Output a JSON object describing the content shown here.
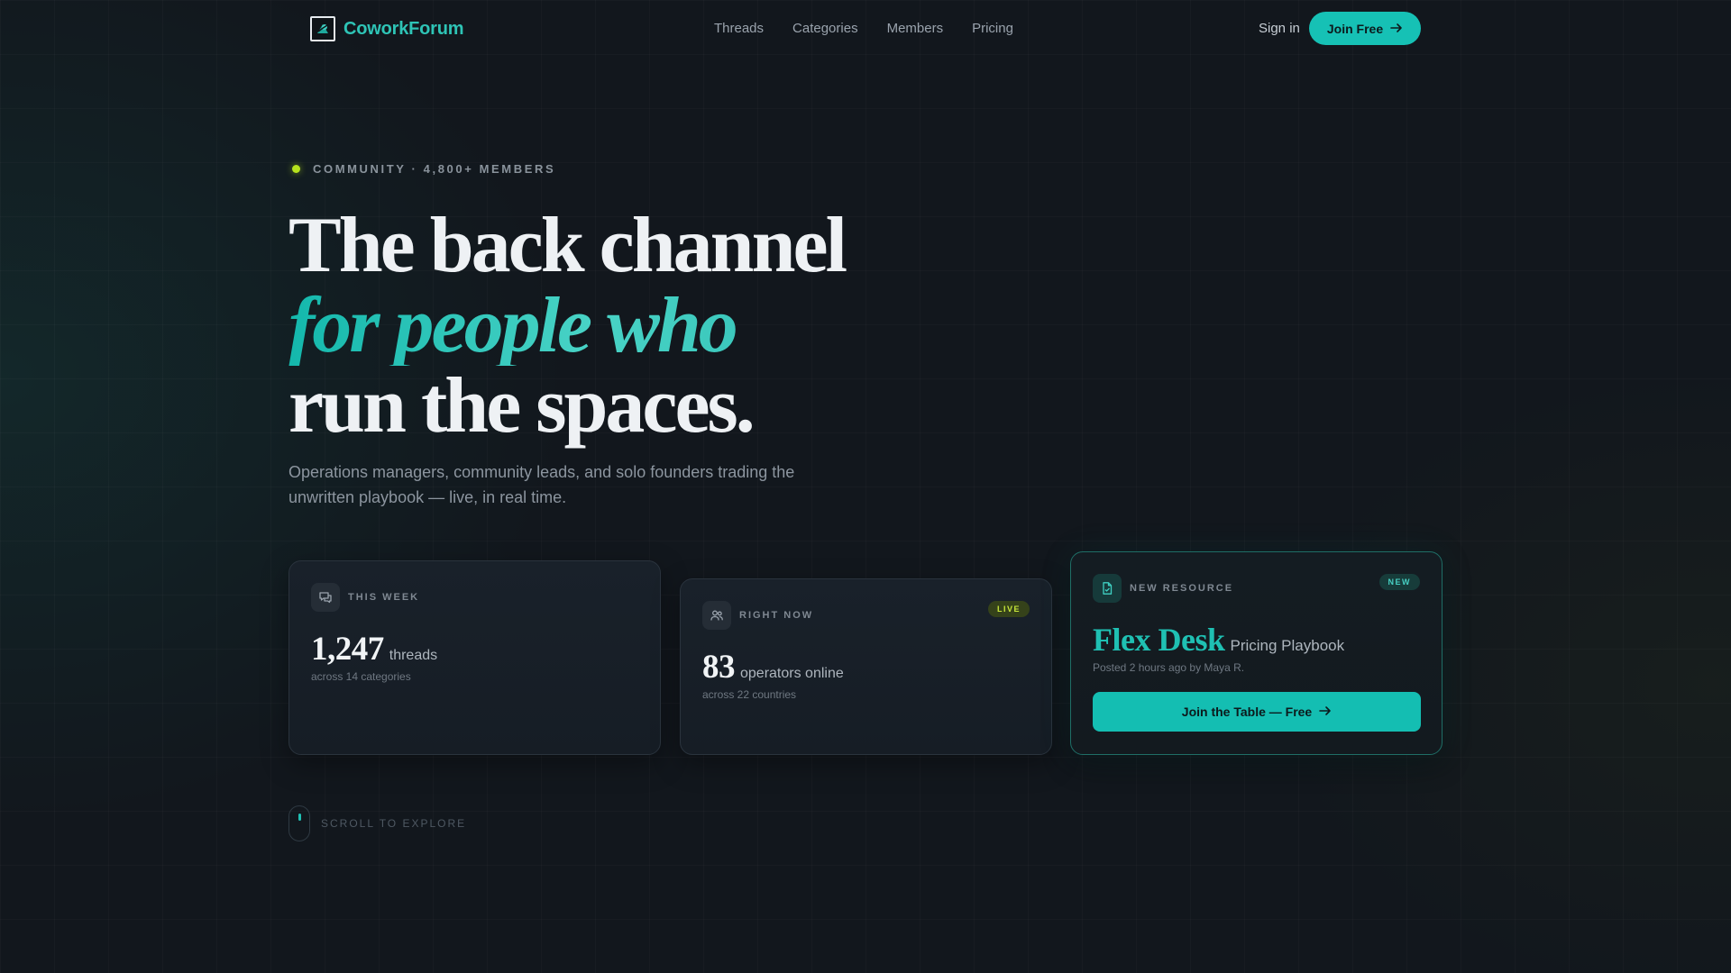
{
  "nav": {
    "brand": "CoworkForum",
    "links": [
      "Threads",
      "Categories",
      "Members",
      "Pricing"
    ],
    "sign_in": "Sign in",
    "join": "Join Free"
  },
  "hero": {
    "eyebrow": "COMMUNITY · 4,800+ MEMBERS",
    "headline_line1": "The back channel",
    "headline_line2": "for people who",
    "headline_line3": "run the spaces.",
    "subhead_line1": "Operations managers, community leads, and solo founders trading the",
    "subhead_line2": "unwritten playbook — live, in real time."
  },
  "cards": {
    "week": {
      "label": "THIS WEEK",
      "value": "1,247",
      "unit": "threads",
      "sub": "across 14 categories",
      "icon": "chat-bubbles-icon"
    },
    "now": {
      "label": "RIGHT NOW",
      "badge": "LIVE",
      "value": "83",
      "unit": "operators online",
      "sub": "across 22 countries",
      "icon": "users-icon"
    },
    "resource": {
      "label": "NEW RESOURCE",
      "badge": "NEW",
      "title_big": "Flex Desk",
      "title_small": "Pricing Playbook",
      "meta": "Posted 2 hours ago by Maya R.",
      "cta": "Join the Table — Free",
      "icon": "document-icon"
    }
  },
  "scroll": {
    "label": "SCROLL TO EXPLORE"
  },
  "colors": {
    "accent": "#16c1b5",
    "live": "#c8e83a",
    "background": "#12171d"
  }
}
